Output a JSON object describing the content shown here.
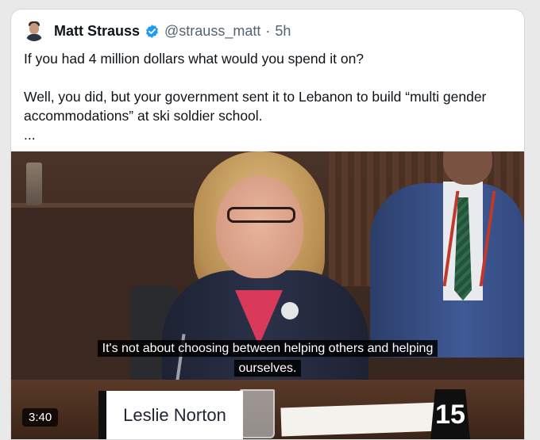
{
  "tweet": {
    "author_name": "Matt Strauss",
    "handle": "@strauss_matt",
    "separator": "·",
    "time": "5h",
    "text_lines": [
      "If you had 4 million dollars what would you spend it on?",
      "Well, you did, but your government sent it to Lebanon to build “multi gender accommodations” at ski soldier school.",
      "..."
    ]
  },
  "media": {
    "caption_line1": "It's not about choosing between helping others and helping",
    "caption_line2": "ourselves.",
    "nameplate": "Leslie Norton",
    "seat_number": "15",
    "duration": "3:40"
  },
  "icons": {
    "verified": "verified-badge-icon"
  },
  "colors": {
    "verified_blue": "#1d9bf0",
    "text": "#0f1419",
    "muted": "#536471"
  }
}
